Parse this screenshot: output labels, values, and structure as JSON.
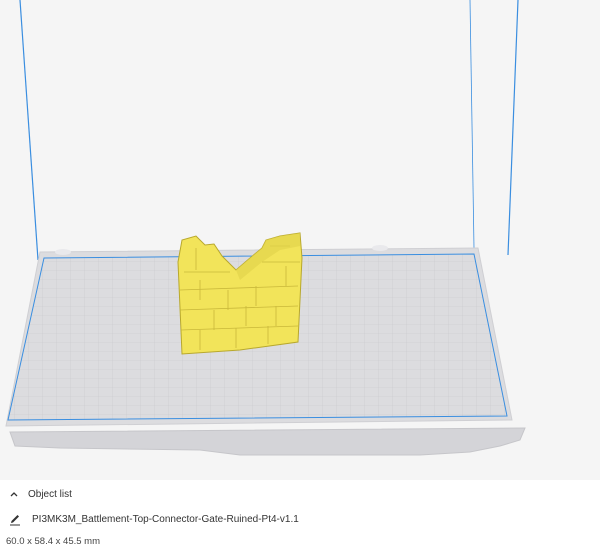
{
  "object_panel": {
    "object_list_label": "Object list",
    "file_name": "PI3MK3M_Battlement-Top-Connector-Gate-Ruined-Pt4-v1.1",
    "dimensions": "60.0 x 58.4 x 45.5 mm"
  },
  "icons": {
    "collapse": "chevron-up-icon",
    "edit": "pencil-icon"
  },
  "colors": {
    "model": "#f2e45a",
    "build_volume": "#3a8ee0",
    "bed": "#d9d9dc"
  }
}
